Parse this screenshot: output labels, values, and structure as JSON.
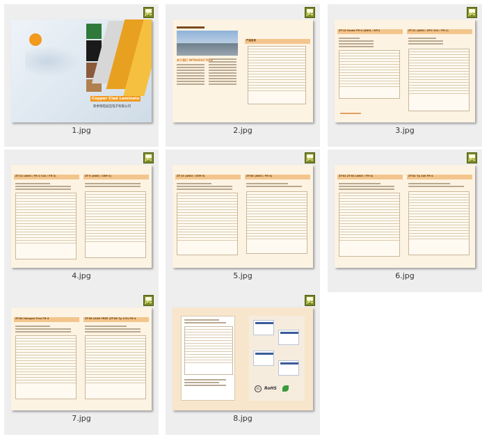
{
  "thumbnails": [
    {
      "caption": "1.jpg",
      "badge": "JPG",
      "kind": "cover",
      "cover_title": "Copper Clad Laminate",
      "company": "新余铜箔层压电子有限公司"
    },
    {
      "caption": "2.jpg",
      "badge": "JPG",
      "kind": "intro",
      "intro_heading": "关于我们 INTRODUCTION",
      "toc_heading": "产品目录"
    },
    {
      "caption": "3.jpg",
      "badge": "JPG",
      "kind": "spec"
    },
    {
      "caption": "4.jpg",
      "badge": "JPG",
      "kind": "spec"
    },
    {
      "caption": "5.jpg",
      "badge": "JPG",
      "kind": "spec"
    },
    {
      "caption": "6.jpg",
      "badge": "JPG",
      "kind": "spec"
    },
    {
      "caption": "7.jpg",
      "badge": "JPG",
      "kind": "spec"
    },
    {
      "caption": "8.jpg",
      "badge": "JPG",
      "kind": "certs",
      "cert_marks": "RoHS"
    }
  ],
  "spec_headers": {
    "t3": [
      "ZT-10 Grade FR-4 (ANSI / XPC)",
      "ZT-21 (ANSI / XPC-210 / FR-1)"
    ],
    "t4": [
      "ZT-22 (ANSI / FR-1-210 / FR-2)",
      "ZT-5 (ANSI / CEM-1)"
    ],
    "t5": [
      "ZT-15 (ANSI / CEM-3)",
      "ZT-80 (ANSI / FR-4)"
    ],
    "t6": [
      "ZT-82 ZT-83 (ANSI / FR-4)",
      "ZT-82 Tg 140 FR-4"
    ],
    "t7": [
      "ZT-84 Halogen Free FR-4",
      "ZT-88 LEAD FREE (ZT-88 Tg 170) FR-4"
    ]
  },
  "colors": {
    "tile_bg": "#eeeeee",
    "page_bg": "#fdf3e3",
    "header_band": "#f3c58c",
    "accent": "#f29a1e"
  }
}
